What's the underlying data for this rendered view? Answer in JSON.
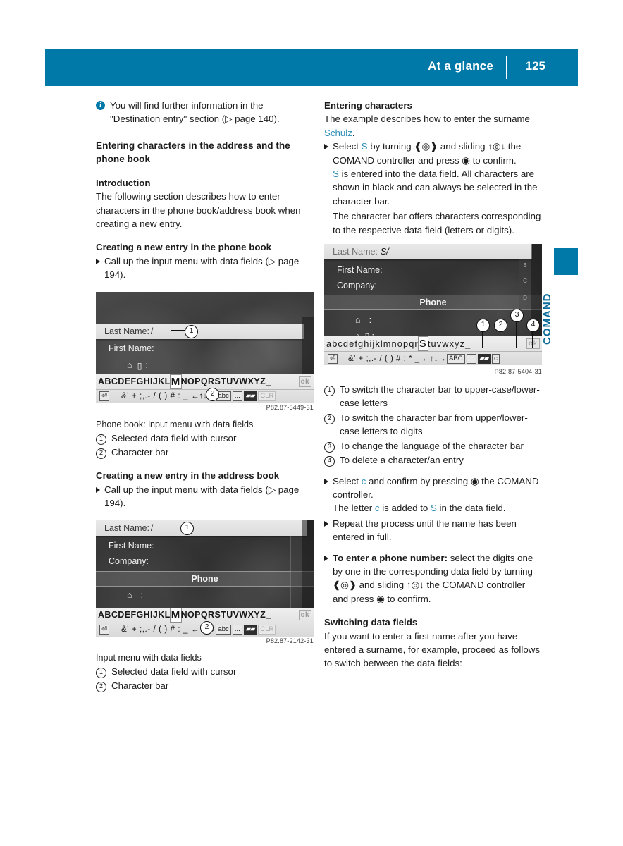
{
  "header": {
    "title": "At a glance",
    "page_number": "125"
  },
  "side_tab": {
    "label": "COMAND"
  },
  "colors": {
    "accent": "#0079a8",
    "text_accent": "#2f8fb5",
    "screen_bg": "#3a3a3a"
  },
  "left_column": {
    "note": {
      "icon": "info-icon",
      "text": "You will find further information in the \"Destination entry\" section (▷ page 140)."
    },
    "section_heading": "Entering characters in the address and the phone book",
    "intro_heading": "Introduction",
    "intro_text": "The following section describes how to enter characters in the phone book/address book when creating a new entry.",
    "phone_book_heading": "Creating a new entry in the phone book",
    "phone_book_step": "Call up the input menu with data fields (▷ page 194).",
    "figure1": {
      "image_id": "P82.87-5449-31",
      "caption": "Phone book: input menu with data fields",
      "legend": [
        {
          "num": "1",
          "text": "Selected data field with cursor"
        },
        {
          "num": "2",
          "text": "Character bar"
        }
      ],
      "screen": {
        "field_selected_label": "Last Name:",
        "field_selected_value": "/",
        "field_2_label": "First Name:",
        "field_3_label": ":",
        "charbar_letters": "ABCDEFGHIJKL",
        "charbar_selected": "M",
        "charbar_letters_tail": "NOPQRSTUVWXYZ_",
        "charbar_ok": "ok",
        "charbar_symbols": "&' + ;,.- / ( ) # :  _",
        "key_back": "⏎",
        "key_abc": "abc",
        "key_more": "...",
        "key_lang": "flag-icon",
        "key_clr": "CLR"
      }
    },
    "address_book_heading": "Creating a new entry in the address book",
    "address_book_step": "Call up the input menu with data fields (▷ page 194).",
    "figure2": {
      "image_id": "P82.87-2142-31",
      "caption": "Input menu with data fields",
      "legend": [
        {
          "num": "1",
          "text": "Selected data field with cursor"
        },
        {
          "num": "2",
          "text": "Character bar"
        }
      ],
      "screen": {
        "field_selected_label": "Last Name:",
        "field_selected_value": "/",
        "field_2_label": "First Name:",
        "field_3_label": "Company:",
        "band_label": "Phone",
        "field_4_label": ":",
        "field_5_label": ":",
        "charbar_letters": "ABCDEFGHIJKL",
        "charbar_selected": "M",
        "charbar_letters_tail": "NOPQRSTUVWXYZ_",
        "charbar_ok": "ok",
        "charbar_symbols": "&' + ;,.- / ( ) # :  _",
        "key_abc": "abc",
        "key_more": "...",
        "key_clr": "CLR"
      }
    }
  },
  "right_column": {
    "entering_heading": "Entering characters",
    "entering_text_pre": "The example describes how to enter the surname ",
    "entering_name": "Schulz",
    "entering_text_post": ".",
    "step1_parts": {
      "a": "Select ",
      "letter": "S",
      "b": " by turning ",
      "turn_icon": "❰◎❱",
      "c": " and sliding ",
      "slide_icon": "↑◎↓",
      "d": " the COMAND controller and press ",
      "press_icon": "◉",
      "e": " to confirm."
    },
    "para_s_pre": "S",
    "para_s_post": " is entered into the data field. All characters are shown in black and can always be selected in the character bar.",
    "para_charbar": "The character bar offers characters corresponding to the respective data field (letters or digits).",
    "figure3": {
      "image_id": "P82.87-5404-31",
      "screen": {
        "field_selected_label": "Last Name:",
        "field_selected_value": "S/",
        "field_2_label": "First Name:",
        "field_3_label": "Company:",
        "band_label": "Phone",
        "field_4_label": ":",
        "field_5_label": ":",
        "charbar_letters": "abcdefghijklmnopqr",
        "charbar_selected": "S",
        "charbar_letters_tail": "tuvwxyz_",
        "charbar_ok": "ok",
        "charbar_symbols": "&' + ;,.- / ( ) # : *  _",
        "key_abc": "ABC",
        "key_more": "...",
        "key_lang": "flag-icon",
        "key_c": "c",
        "scroll_letters": [
          "B",
          "C",
          "D"
        ]
      },
      "legend": [
        {
          "num": "1",
          "text": "To switch the character bar to upper-case/lower-case letters"
        },
        {
          "num": "2",
          "text": "To switch the character bar from upper/lower-case letters to digits"
        },
        {
          "num": "3",
          "text": "To change the language of the character bar"
        },
        {
          "num": "4",
          "text": "To delete a character/an entry"
        }
      ]
    },
    "step2_parts": {
      "a": "Select ",
      "letter": "c",
      "b": " and confirm by pressing ",
      "press_icon": "◉",
      "c": " the COMAND controller."
    },
    "step2_result_pre": "The letter ",
    "step2_result_c": "c",
    "step2_result_mid": " is added to ",
    "step2_result_s": "S",
    "step2_result_post": " in the data field.",
    "step3": "Repeat the process until the name has been entered in full.",
    "step4_parts": {
      "bold": "To enter a phone number:",
      "a": " select the digits one by one in the corresponding data field by turning ",
      "turn_icon": "❰◎❱",
      "b": " and sliding ",
      "slide_icon": "↑◎↓",
      "c": " the COMAND controller and press ",
      "press_icon": "◉",
      "d": " to confirm."
    },
    "switching_heading": "Switching data fields",
    "switching_text": "If you want to enter a first name after you have entered a surname, for example, proceed as follows to switch between the data fields:"
  }
}
